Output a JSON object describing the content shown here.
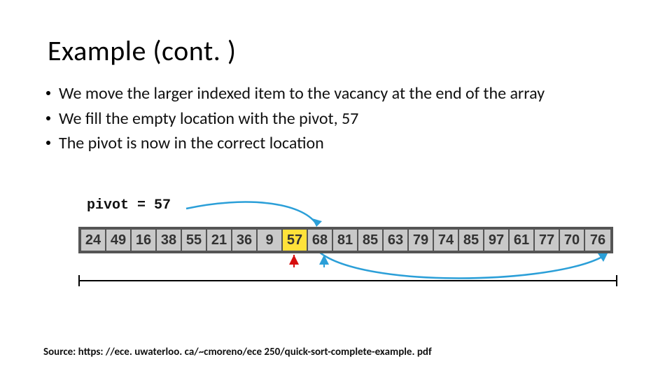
{
  "title": "Example (cont. )",
  "bullets": [
    "We move the larger indexed item to the vacancy at the end of the array",
    "We fill the empty location with the pivot, 57",
    "The pivot is now in the correct location"
  ],
  "pivot_label": "pivot = 57",
  "cells": [
    "24",
    "49",
    "16",
    "38",
    "55",
    "21",
    "36",
    "9",
    "57",
    "68",
    "81",
    "85",
    "63",
    "79",
    "74",
    "85",
    "97",
    "61",
    "77",
    "70",
    "76"
  ],
  "highlight_index": 8,
  "red_arrow_index": 7,
  "blue_arrow_index": 8,
  "source": "Source: https: //ece. uwaterloo. ca/~cmoreno/ece 250/quick-sort-complete-example. pdf"
}
